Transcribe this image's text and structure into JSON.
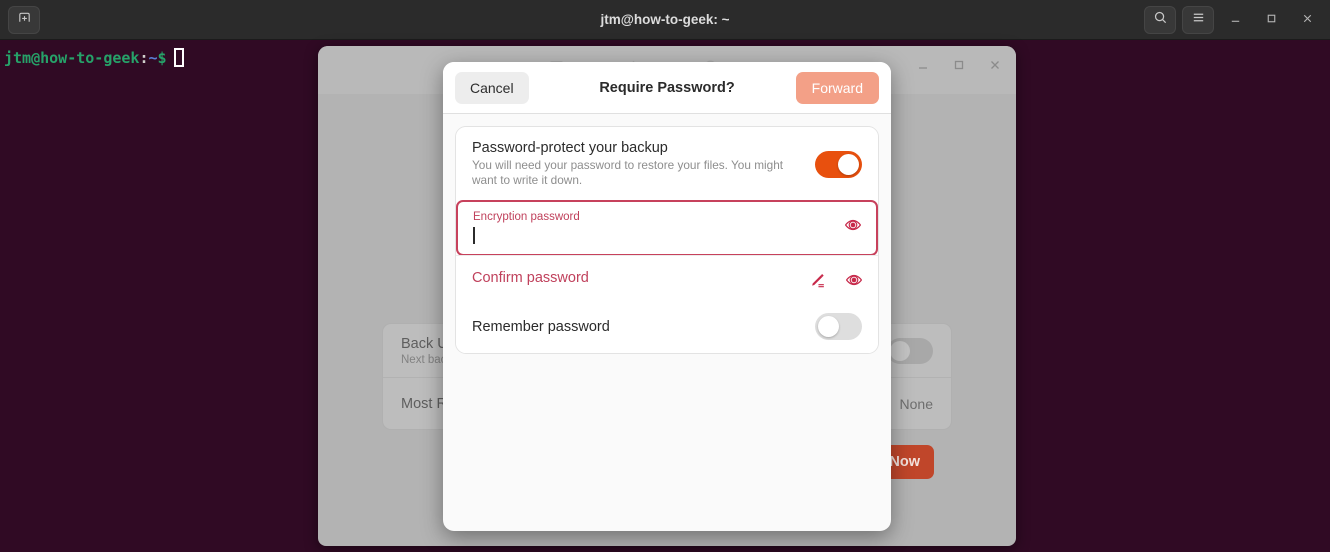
{
  "terminal": {
    "title": "jtm@how-to-geek: ~",
    "new_tab_icon": "new-tab-icon",
    "search_icon": "search-icon",
    "menu_icon": "hamburger-menu-icon",
    "minimize_icon": "minimize-icon",
    "maximize_icon": "maximize-icon",
    "close_icon": "close-icon",
    "prompt": {
      "user_host": "jtm@how-to-geek",
      "colon": ":",
      "path": "~",
      "sigil": "$"
    }
  },
  "background_window": {
    "minimize_icon": "minimize-icon",
    "maximize_icon": "maximize-icon",
    "close_icon": "close-icon",
    "rows": [
      {
        "title": "Back Up",
        "subtitle": "Next bac",
        "value": ""
      },
      {
        "title": "Most R",
        "subtitle": "",
        "value": "None"
      }
    ],
    "backup_button": "p Now"
  },
  "dialog": {
    "title": "Require Password?",
    "cancel_label": "Cancel",
    "forward_label": "Forward",
    "password_protect": {
      "title": "Password-protect your backup",
      "subtitle": "You will need your password to restore your files. You might want to write it down.",
      "toggle_state": "on"
    },
    "encryption_password": {
      "label": "Encryption password",
      "value": "",
      "reveal_icon": "eye-reveal-icon"
    },
    "confirm_password": {
      "label": "Confirm password",
      "value": "",
      "caps_lock_icon": "caps-lock-warning-icon",
      "reveal_icon": "eye-reveal-icon"
    },
    "remember_password": {
      "title": "Remember password",
      "toggle_state": "off"
    }
  },
  "colors": {
    "terminal_bg": "#300a24",
    "headerbar_bg": "#2b2b2b",
    "prompt_green": "#26a269",
    "prompt_blue": "#5b7ed6",
    "accent_orange": "#e8500e",
    "forward_disabled": "#f3a087",
    "error_crimson": "#c0415c",
    "backup_button": "#c0462a"
  }
}
